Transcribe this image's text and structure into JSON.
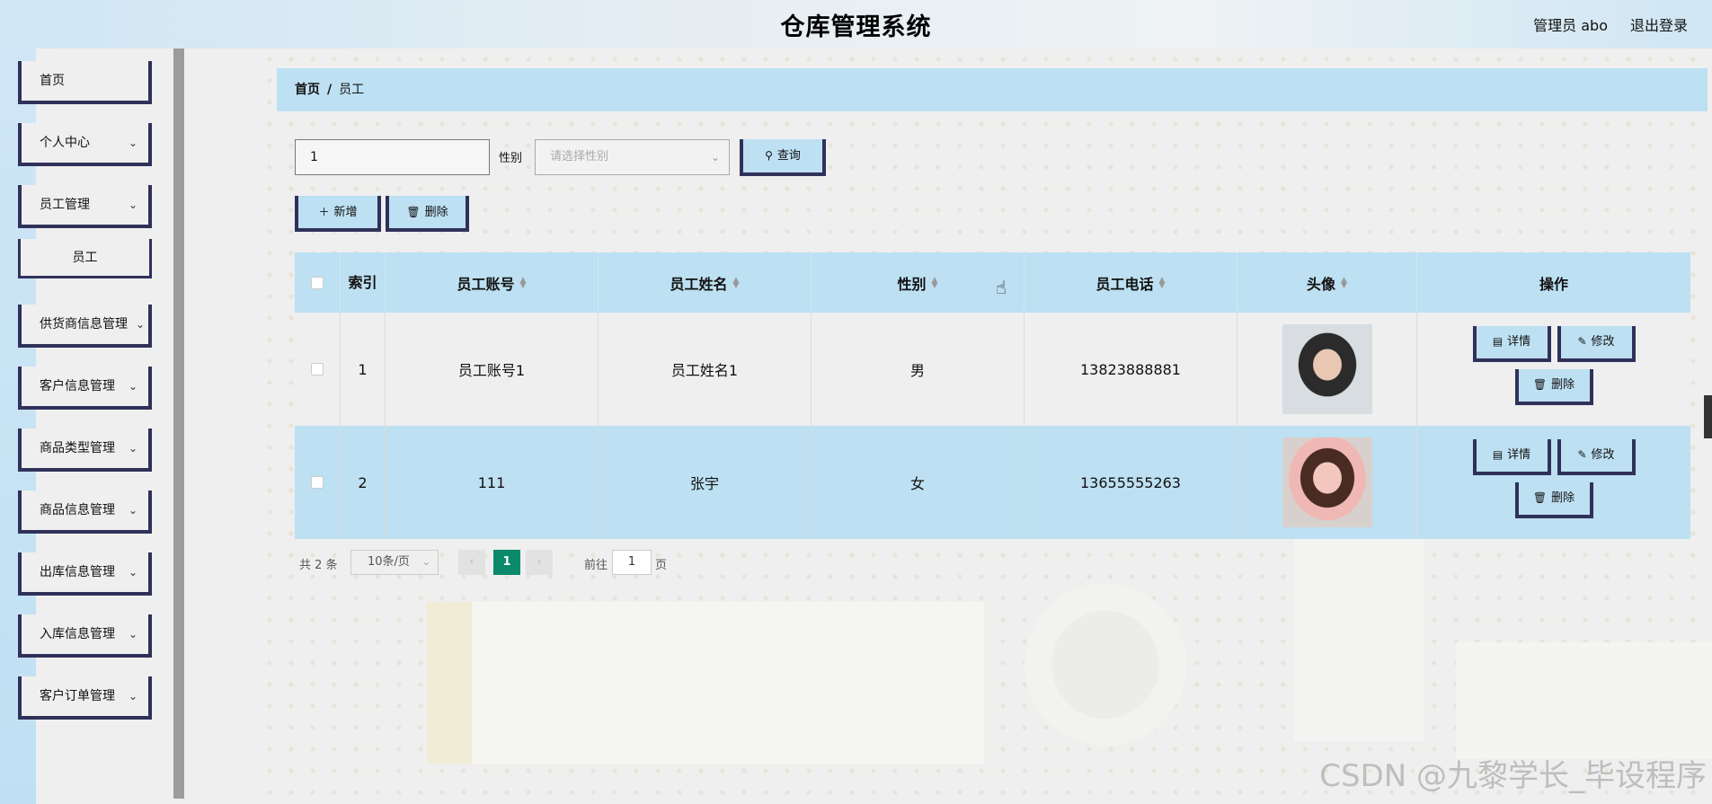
{
  "header": {
    "title": "仓库管理系统",
    "user": "管理员 abo",
    "logout": "退出登录"
  },
  "sidebar": {
    "items": [
      {
        "label": "首页",
        "has_children": false
      },
      {
        "label": "个人中心",
        "has_children": true
      },
      {
        "label": "员工管理",
        "has_children": true,
        "children": [
          "员工"
        ]
      },
      {
        "label": "供货商信息管理",
        "has_children": true
      },
      {
        "label": "客户信息管理",
        "has_children": true
      },
      {
        "label": "商品类型管理",
        "has_children": true
      },
      {
        "label": "商品信息管理",
        "has_children": true
      },
      {
        "label": "出库信息管理",
        "has_children": true
      },
      {
        "label": "入库信息管理",
        "has_children": true
      },
      {
        "label": "客户订单管理",
        "has_children": true
      }
    ]
  },
  "breadcrumb": {
    "home": "首页",
    "sep": "/",
    "current": "员工"
  },
  "search": {
    "keyword_value": "1",
    "gender_label": "性别",
    "gender_placeholder": "请选择性别",
    "search_button": "查询"
  },
  "actions": {
    "add": "新增",
    "delete": "删除"
  },
  "table": {
    "columns": [
      "索引",
      "员工账号",
      "员工姓名",
      "性别",
      "员工电话",
      "头像",
      "操作"
    ],
    "rows": [
      {
        "index": "1",
        "account": "员工账号1",
        "name": "员工姓名1",
        "gender": "男",
        "phone": "13823888881",
        "avatar": "avatar-photo-1"
      },
      {
        "index": "2",
        "account": "111",
        "name": "张宇",
        "gender": "女",
        "phone": "13655555263",
        "avatar": "avatar-photo-2"
      }
    ],
    "row_actions": {
      "detail": "详情",
      "edit": "修改",
      "delete": "删除"
    }
  },
  "pagination": {
    "total": "共 2 条",
    "page_size": "10条/页",
    "current_page": "1",
    "goto_label": "前往",
    "goto_value": "1",
    "goto_unit": "页"
  },
  "watermark": "CSDN @九黎学长_毕设程序",
  "colors": {
    "accent": "#bde0f2",
    "border": "#30315a",
    "active_page": "#0a8a6a"
  }
}
